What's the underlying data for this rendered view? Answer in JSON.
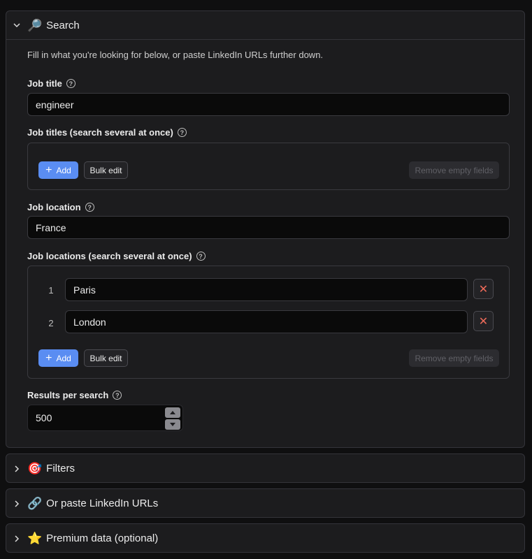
{
  "search": {
    "title": "Search",
    "emoji": "🔎",
    "hint": "Fill in what you're looking for below, or paste LinkedIn URLs further down.",
    "job_title": {
      "label": "Job title",
      "value": "engineer"
    },
    "job_titles_multi": {
      "label": "Job titles (search several at once)",
      "add_label": "Add",
      "bulk_label": "Bulk edit",
      "remove_label": "Remove empty fields"
    },
    "job_location": {
      "label": "Job location",
      "value": "France"
    },
    "job_locations_multi": {
      "label": "Job locations (search several at once)",
      "rows": [
        {
          "index": "1",
          "value": "Paris"
        },
        {
          "index": "2",
          "value": "London"
        }
      ],
      "add_label": "Add",
      "bulk_label": "Bulk edit",
      "remove_label": "Remove empty fields"
    },
    "results_per_search": {
      "label": "Results per search",
      "value": "500"
    }
  },
  "sections": {
    "filters": {
      "emoji": "🎯",
      "title": "Filters"
    },
    "linkedin_urls": {
      "emoji": "🔗",
      "title": "Or paste LinkedIn URLs"
    },
    "premium": {
      "emoji": "⭐",
      "title": "Premium data (optional)"
    }
  },
  "colors": {
    "accent": "#5a8df2",
    "danger": "#ef6b5a",
    "background": "#0f0f10",
    "panel": "#1c1c1e"
  }
}
